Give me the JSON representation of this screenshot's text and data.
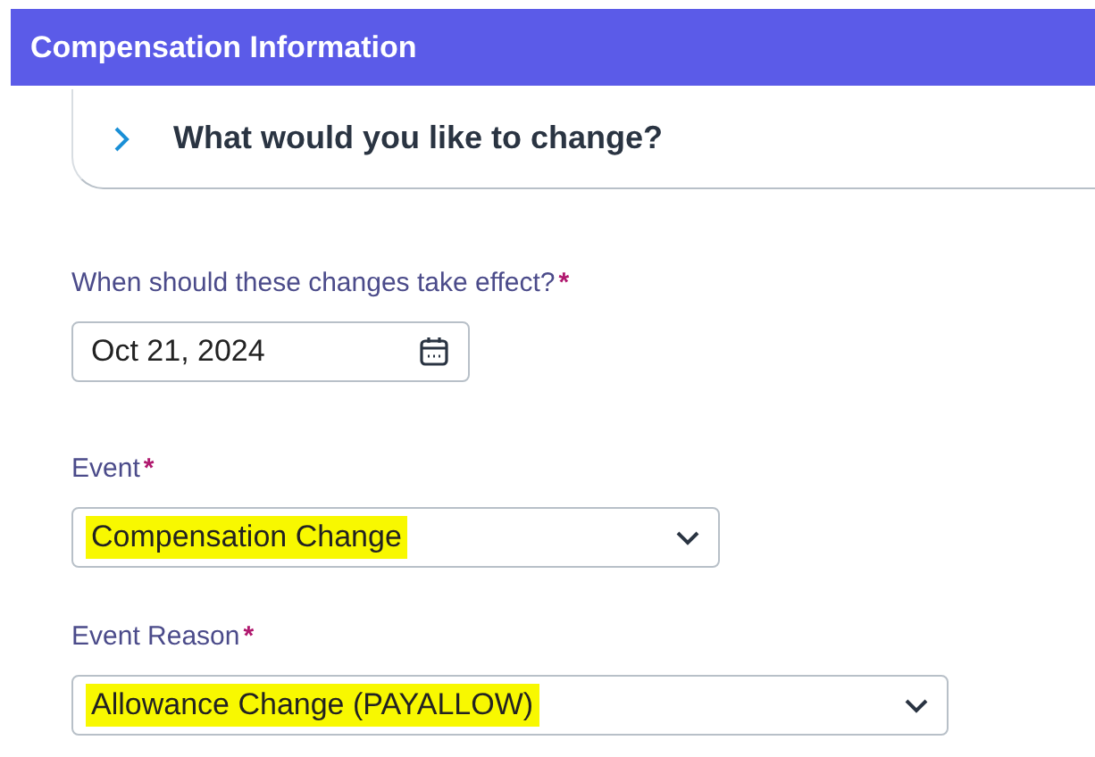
{
  "header": {
    "title": "Compensation Information"
  },
  "section": {
    "title": "What would you like to change?",
    "expanded": false
  },
  "fields": [
    {
      "kind": "date",
      "label": "When should these changes take effect?",
      "required_mark": "*",
      "value": "Oct 21, 2024",
      "highlighted": false
    },
    {
      "kind": "select",
      "label": "Event",
      "required_mark": "*",
      "value": "Compensation Change",
      "highlighted": true
    },
    {
      "kind": "select",
      "label": "Event Reason",
      "required_mark": "*",
      "value": "Allowance Change (PAYALLOW)",
      "highlighted": true
    }
  ]
}
